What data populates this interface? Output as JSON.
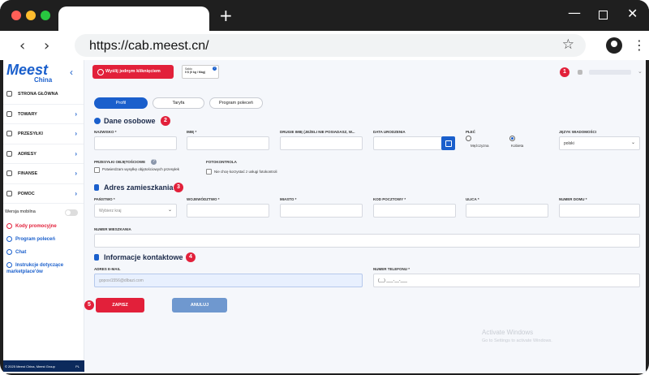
{
  "browser": {
    "url": "https://cab.meest.cn/"
  },
  "sidebar": {
    "logo": "Meest",
    "logo_sub": "China",
    "menu": [
      {
        "label": "STRONA GŁÓWNA",
        "chevron": false
      },
      {
        "label": "TOWARY",
        "chevron": true
      },
      {
        "label": "PRZESYŁKI",
        "chevron": true
      },
      {
        "label": "ADRESY",
        "chevron": true
      },
      {
        "label": "FINANSE",
        "chevron": true
      },
      {
        "label": "POMOC",
        "chevron": true
      }
    ],
    "mobile_version": "Wersja mobilna",
    "links": [
      {
        "label": "Kody promocyjne",
        "accent": true
      },
      {
        "label": "Program poleceń",
        "accent": false
      },
      {
        "label": "Chat",
        "accent": false
      },
      {
        "label": "Instrukcje dotyczące marketplace'ów",
        "accent": false
      }
    ],
    "footer": "© 2025 Meest China, Meest Group",
    "footer_lang": "PL"
  },
  "header": {
    "send_button": "Wyślij jednym kliknięciem",
    "saldo_label": "Saldo",
    "saldo_value": "0 $ (0 kg / Mag)"
  },
  "tabs": [
    "Profil",
    "Taryfa",
    "Program poleceń"
  ],
  "sections": {
    "personal": {
      "title": "Dane osobowe",
      "badge": "2",
      "fields": {
        "surname": "NAZWISKO *",
        "name": "IMIĘ *",
        "middle_name": "DRUGIE IMIĘ (JEŻELI NIE POSIADASZ, W...",
        "birth_date": "DATA URODZENIA",
        "gender": "PŁEĆ",
        "male": "Mężczyzna",
        "female": "Kobieta",
        "lang": "JĘZYK WIADOMOŚCI",
        "lang_value": "polski",
        "bulky": "PRZESYŁKI OBJĘTOŚCIOWE",
        "bulky_confirm": "Potwierdzam wysyłkę objętościowych przesyłek",
        "photo": "FOTOKONTROLA",
        "photo_optout": "Nie chcę korzystać z usługi fotokontroli"
      }
    },
    "address": {
      "title": "Adres zamieszkania",
      "badge": "3",
      "fields": {
        "country": "PAŃSTWO *",
        "country_placeholder": "Wybierz kraj",
        "province": "WOJEWÓDZTWO *",
        "city": "MIASTO *",
        "postcode": "KOD POCZTOWY *",
        "street": "ULICA *",
        "house": "NUMER DOMU *",
        "apartment": "NUMER MIESZKANIA"
      }
    },
    "contact": {
      "title": "Informacje kontaktowe",
      "badge": "4",
      "fields": {
        "email": "ADRES E-MAIL",
        "email_value": "gopoxi1556@dlbazi.com",
        "phone": "NUMER TELEFONU *",
        "phone_value": "(__) ___-__-___"
      }
    }
  },
  "actions": {
    "save": "ZAPISZ",
    "cancel": "ANULUJ",
    "badge": "5"
  },
  "badges": {
    "user": "1"
  },
  "watermark": {
    "title": "Activate Windows",
    "subtitle": "Go to Settings to activate Windows."
  },
  "colors": {
    "brand_blue": "#1a5fcc",
    "accent_red": "#e2203a",
    "navy": "#0c2a5c"
  }
}
